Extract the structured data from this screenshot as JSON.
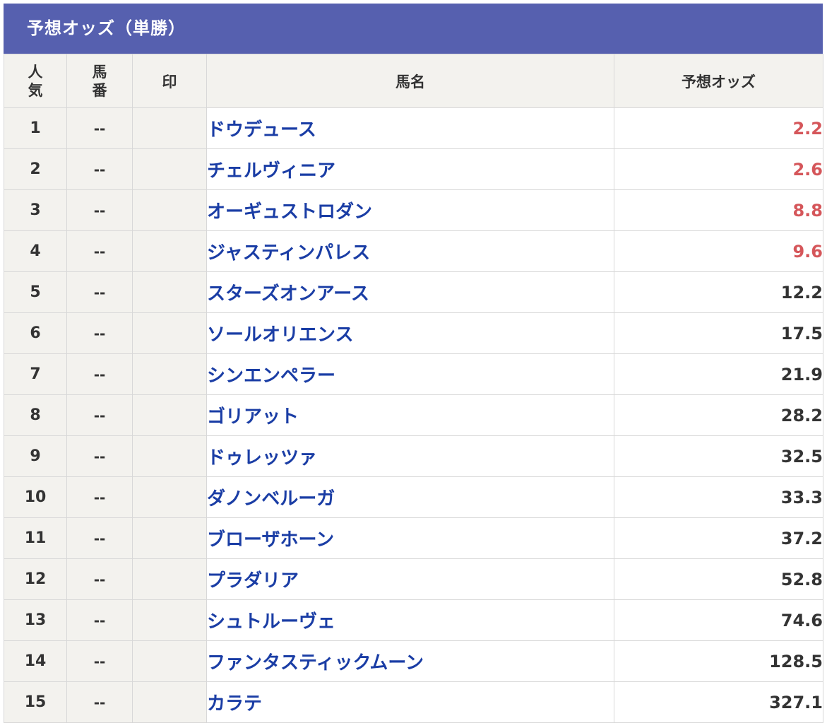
{
  "title": "予想オッズ（単勝）",
  "columns": {
    "popularity": "人\n気",
    "horse_number": "馬\n番",
    "mark": "印",
    "horse_name": "馬名",
    "odds": "予想オッズ"
  },
  "colors": {
    "header_bg": "#5660af",
    "hot_odds": "#d5565a",
    "horse_link": "#1a3da5",
    "cell_bg": "#f3f2ee"
  },
  "rows": [
    {
      "pop": "1",
      "num": "--",
      "mark": "",
      "name": "ドウデュース",
      "odds": "2.2",
      "hot": true
    },
    {
      "pop": "2",
      "num": "--",
      "mark": "",
      "name": "チェルヴィニア",
      "odds": "2.6",
      "hot": true
    },
    {
      "pop": "3",
      "num": "--",
      "mark": "",
      "name": "オーギュストロダン",
      "odds": "8.8",
      "hot": true
    },
    {
      "pop": "4",
      "num": "--",
      "mark": "",
      "name": "ジャスティンパレス",
      "odds": "9.6",
      "hot": true
    },
    {
      "pop": "5",
      "num": "--",
      "mark": "",
      "name": "スターズオンアース",
      "odds": "12.2",
      "hot": false
    },
    {
      "pop": "6",
      "num": "--",
      "mark": "",
      "name": "ソールオリエンス",
      "odds": "17.5",
      "hot": false
    },
    {
      "pop": "7",
      "num": "--",
      "mark": "",
      "name": "シンエンペラー",
      "odds": "21.9",
      "hot": false
    },
    {
      "pop": "8",
      "num": "--",
      "mark": "",
      "name": "ゴリアット",
      "odds": "28.2",
      "hot": false
    },
    {
      "pop": "9",
      "num": "--",
      "mark": "",
      "name": "ドゥレッツァ",
      "odds": "32.5",
      "hot": false
    },
    {
      "pop": "10",
      "num": "--",
      "mark": "",
      "name": "ダノンベルーガ",
      "odds": "33.3",
      "hot": false
    },
    {
      "pop": "11",
      "num": "--",
      "mark": "",
      "name": "ブローザホーン",
      "odds": "37.2",
      "hot": false
    },
    {
      "pop": "12",
      "num": "--",
      "mark": "",
      "name": "プラダリア",
      "odds": "52.8",
      "hot": false
    },
    {
      "pop": "13",
      "num": "--",
      "mark": "",
      "name": "シュトルーヴェ",
      "odds": "74.6",
      "hot": false
    },
    {
      "pop": "14",
      "num": "--",
      "mark": "",
      "name": "ファンタスティックムーン",
      "odds": "128.5",
      "hot": false
    },
    {
      "pop": "15",
      "num": "--",
      "mark": "",
      "name": "カラテ",
      "odds": "327.1",
      "hot": false
    }
  ]
}
